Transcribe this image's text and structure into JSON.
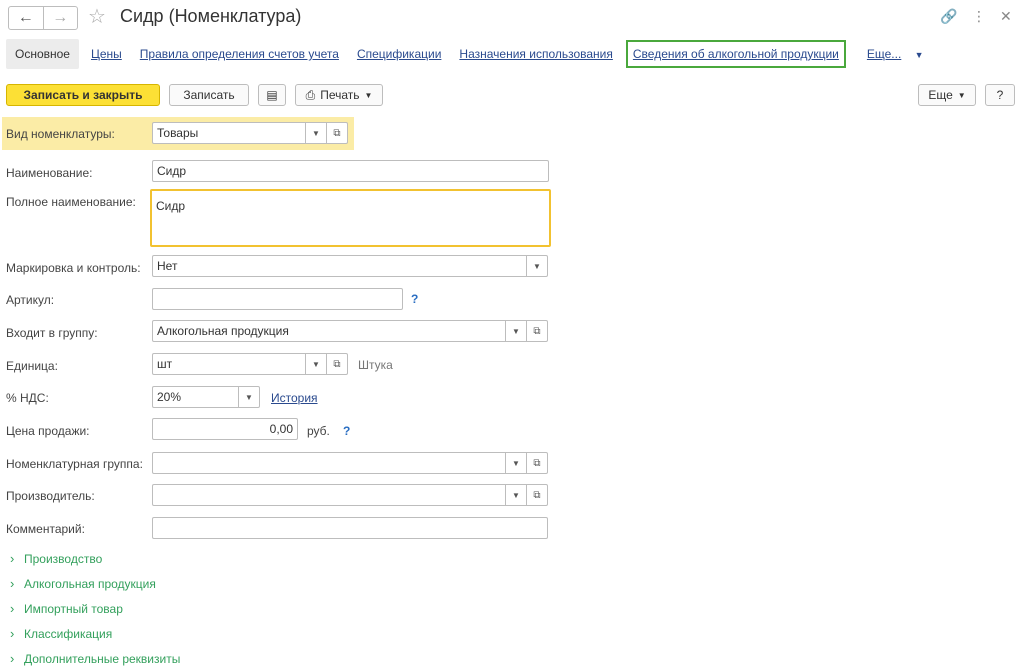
{
  "window": {
    "title": "Сидр (Номенклатура)"
  },
  "tabs": [
    {
      "label": "Основное"
    },
    {
      "label": "Цены"
    },
    {
      "label": "Правила определения счетов учета"
    },
    {
      "label": "Спецификации"
    },
    {
      "label": "Назначения использования"
    },
    {
      "label": "Сведения об алкогольной продукции"
    },
    {
      "label": "Еще..."
    }
  ],
  "toolbar": {
    "save_close": "Записать и закрыть",
    "save": "Записать",
    "print": "Печать",
    "more": "Еще",
    "help": "?"
  },
  "form": {
    "kind_label": "Вид номенклатуры:",
    "kind_value": "Товары",
    "name_label": "Наименование:",
    "name_value": "Сидр",
    "fullname_label": "Полное наименование:",
    "fullname_value": "Сидр",
    "marking_label": "Маркировка и контроль:",
    "marking_value": "Нет",
    "article_label": "Артикул:",
    "article_value": "",
    "group_label": "Входит в группу:",
    "group_value": "Алкогольная продукция",
    "unit_label": "Единица:",
    "unit_value": "шт",
    "unit_name": "Штука",
    "vat_label": "% НДС:",
    "vat_value": "20%",
    "vat_history": "История",
    "price_label": "Цена продажи:",
    "price_value": "0,00",
    "price_currency": "руб.",
    "nomgroup_label": "Номенклатурная группа:",
    "nomgroup_value": "",
    "producer_label": "Производитель:",
    "producer_value": "",
    "comment_label": "Комментарий:",
    "comment_value": "",
    "help_mark": "?"
  },
  "groups": [
    {
      "label": "Производство"
    },
    {
      "label": "Алкогольная продукция"
    },
    {
      "label": "Импортный товар"
    },
    {
      "label": "Классификация"
    },
    {
      "label": "Дополнительные реквизиты"
    }
  ]
}
